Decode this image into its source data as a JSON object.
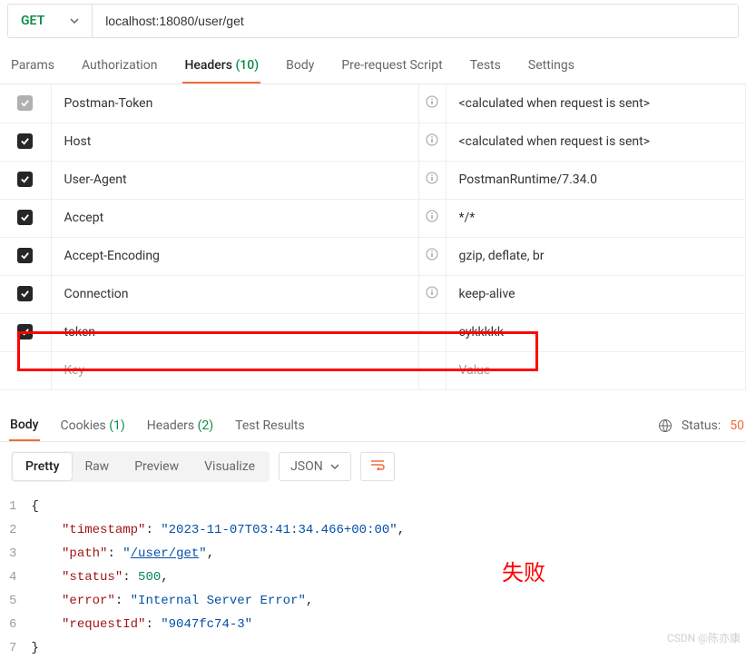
{
  "request": {
    "method": "GET",
    "url": "localhost:18080/user/get"
  },
  "tabs": {
    "params": "Params",
    "auth": "Authorization",
    "headers_label": "Headers",
    "headers_count": "(10)",
    "body": "Body",
    "prereq": "Pre-request Script",
    "tests": "Tests",
    "settings": "Settings"
  },
  "headers": [
    {
      "key": "Postman-Token",
      "value": "<calculated when request is sent>",
      "info": true,
      "disabled": true
    },
    {
      "key": "Host",
      "value": "<calculated when request is sent>",
      "info": true,
      "disabled": false
    },
    {
      "key": "User-Agent",
      "value": "PostmanRuntime/7.34.0",
      "info": true,
      "disabled": false
    },
    {
      "key": "Accept",
      "value": "*/*",
      "info": true,
      "disabled": false
    },
    {
      "key": "Accept-Encoding",
      "value": "gzip, deflate, br",
      "info": true,
      "disabled": false
    },
    {
      "key": "Connection",
      "value": "keep-alive",
      "info": true,
      "disabled": false
    },
    {
      "key": "token",
      "value": "cykkkkk",
      "info": false,
      "disabled": false
    }
  ],
  "headers_placeholder": {
    "key": "Key",
    "value": "Value"
  },
  "response_tabs": {
    "body": "Body",
    "cookies_label": "Cookies",
    "cookies_count": "(1)",
    "headers_label": "Headers",
    "headers_count": "(2)",
    "tests": "Test Results",
    "status_label": "Status:",
    "status_value": "50"
  },
  "view": {
    "pretty": "Pretty",
    "raw": "Raw",
    "preview": "Preview",
    "visualize": "Visualize",
    "format": "JSON"
  },
  "json_body": {
    "timestamp_key": "\"timestamp\"",
    "timestamp_val": "\"2023-11-07T03:41:34.466+00:00\"",
    "path_key": "\"path\"",
    "path_val_open": "\"",
    "path_val_link": "/user/get",
    "path_val_close": "\"",
    "status_key": "\"status\"",
    "status_val": "500",
    "error_key": "\"error\"",
    "error_val": "\"Internal Server Error\"",
    "requestId_key": "\"requestId\"",
    "requestId_val": "\"9047fc74-3\""
  },
  "lines": [
    "1",
    "2",
    "3",
    "4",
    "5",
    "6",
    "7"
  ],
  "brace_open": "{",
  "brace_close": "}",
  "colon": ": ",
  "comma": ",",
  "fail_text": "失败",
  "watermark": "CSDN @陈亦康"
}
